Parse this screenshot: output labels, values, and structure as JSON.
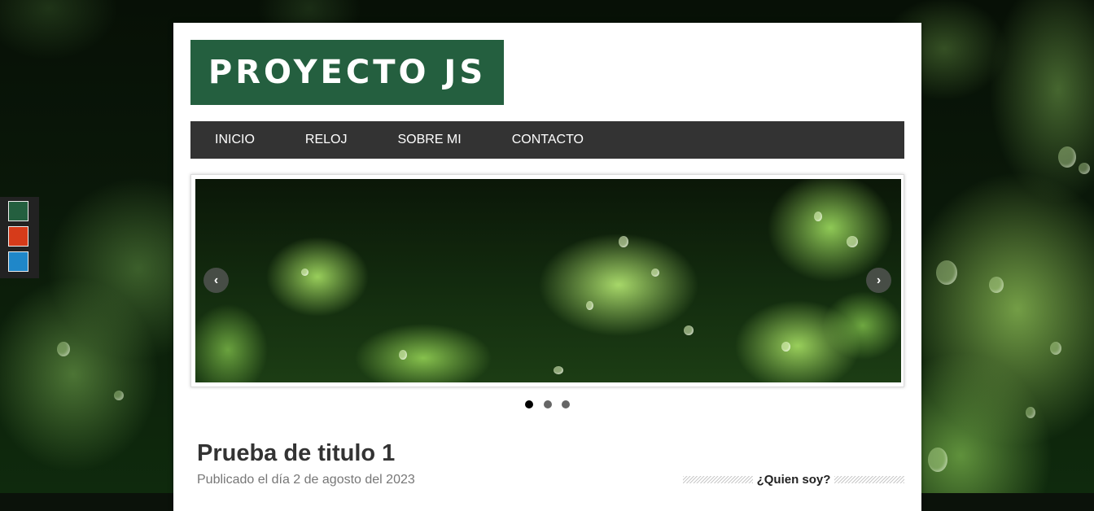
{
  "site": {
    "logo_text": "PROYECTO JS"
  },
  "nav": {
    "items": [
      {
        "label": "INICIO"
      },
      {
        "label": "RELOJ"
      },
      {
        "label": "SOBRE MI"
      },
      {
        "label": "CONTACTO"
      }
    ]
  },
  "theme_switcher": {
    "colors": [
      "#245f3f",
      "#d63b1a",
      "#1f87c9"
    ]
  },
  "slider": {
    "prev_icon": "chevron-left-icon",
    "next_icon": "chevron-right-icon",
    "prev_glyph": "‹",
    "next_glyph": "›",
    "slide_count": 3,
    "active_slide": 1
  },
  "post": {
    "title": "Prueba de titulo 1",
    "date": "Publicado el día 2 de agosto del 2023"
  },
  "sidebar": {
    "widget_title": "¿Quien soy?"
  }
}
